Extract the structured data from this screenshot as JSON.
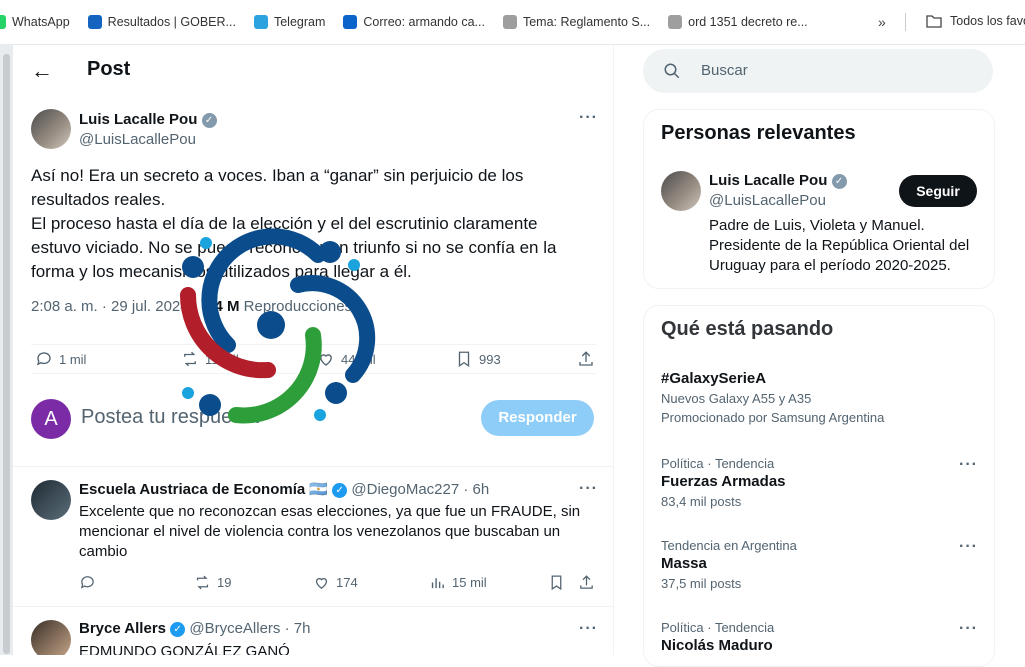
{
  "bookmarks": [
    {
      "label": "WhatsApp",
      "color": "#25d366"
    },
    {
      "label": "Resultados | GOBER...",
      "color": "#1565c0"
    },
    {
      "label": "Telegram",
      "color": "#2aa3df"
    },
    {
      "label": "Correo: armando ca...",
      "color": "#0a64c9"
    },
    {
      "label": "Tema: Reglamento S...",
      "color": "#9e9e9e"
    },
    {
      "label": "ord 1351 decreto re...",
      "color": "#9e9e9e"
    }
  ],
  "bookmarks_more": "»",
  "all_favorites": "Todos los favoritos",
  "page_title": "Post",
  "main_tweet": {
    "name": "Luis Lacalle Pou",
    "handle": "@LuisLacallePou",
    "para1": "Así no! Era un secreto a voces. Iban a “ganar” sin perjuicio de los resultados reales.",
    "para2": "El proceso hasta el día de la elección y el del escrutinio claramente estuvo viciado. No se puede reconocer un triunfo si no se confía en la forma y los mecanismos utilizados para llegar a él.",
    "time": "2:08 a. m.",
    "date": "29 jul. 2024",
    "views": "1,4 M",
    "views_label": "Reproducciones",
    "replies": "1 mil",
    "reposts": "11 mil",
    "likes": "44 mil",
    "bookmarks": "993"
  },
  "reply_box": {
    "avatar_letter": "A",
    "placeholder": "Postea tu respuesta",
    "button": "Responder"
  },
  "replies": [
    {
      "name": "Escuela Austriaca de Economía",
      "flag": "🇦🇷",
      "handle": "@DiegoMac227",
      "time": "6h",
      "text": "Excelente que no reconozcan esas elecciones, ya que fue un FRAUDE, sin mencionar el nivel de violencia contra los venezolanos que buscaban un cambio",
      "replies": "",
      "reposts": "19",
      "likes": "174",
      "views": "15 mil"
    },
    {
      "name": "Bryce Allers",
      "handle": "@BryceAllers",
      "time": "7h",
      "text": "EDMUNDO GONZÁLEZ GANÓ"
    }
  ],
  "search": {
    "placeholder": "Buscar"
  },
  "relevant": {
    "title": "Personas relevantes",
    "name": "Luis Lacalle Pou",
    "handle": "@LuisLacallePou",
    "follow": "Seguir",
    "bio": "Padre de Luis, Violeta y Manuel. Presidente de la República Oriental del Uruguay para el período 2020-2025."
  },
  "trends": {
    "title": "Qué está pasando",
    "items": [
      {
        "category": "",
        "topic": "#GalaxySerieA",
        "count": "Nuevos Galaxy A55 y A35",
        "promo": "Promocionado por Samsung Argentina"
      },
      {
        "category": "Política · Tendencia",
        "topic": "Fuerzas Armadas",
        "count": "83,4 mil posts"
      },
      {
        "category": "Tendencia en Argentina",
        "topic": "Massa",
        "count": "37,5 mil posts"
      },
      {
        "category": "Política · Tendencia",
        "topic": "Nicolás Maduro",
        "count": ""
      }
    ]
  },
  "colors": {
    "accent": "#1d9bf0",
    "logo_blue": "#0b4d8c",
    "logo_red": "#b21e2a",
    "logo_green": "#2e9e3a",
    "logo_cyan": "#1aa3dd"
  }
}
